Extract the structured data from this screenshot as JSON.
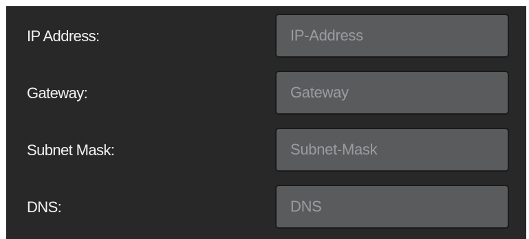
{
  "network_settings": {
    "fields": [
      {
        "label": "IP Address:",
        "placeholder": "IP-Address",
        "value": ""
      },
      {
        "label": "Gateway:",
        "placeholder": "Gateway",
        "value": ""
      },
      {
        "label": "Subnet Mask:",
        "placeholder": "Subnet-Mask",
        "value": ""
      },
      {
        "label": "DNS:",
        "placeholder": "DNS",
        "value": ""
      }
    ]
  },
  "colors": {
    "panel_background": "#282828",
    "field_background": "#595b5d",
    "label_text": "#f2f2f2",
    "placeholder_text": "#9a9d9f"
  }
}
